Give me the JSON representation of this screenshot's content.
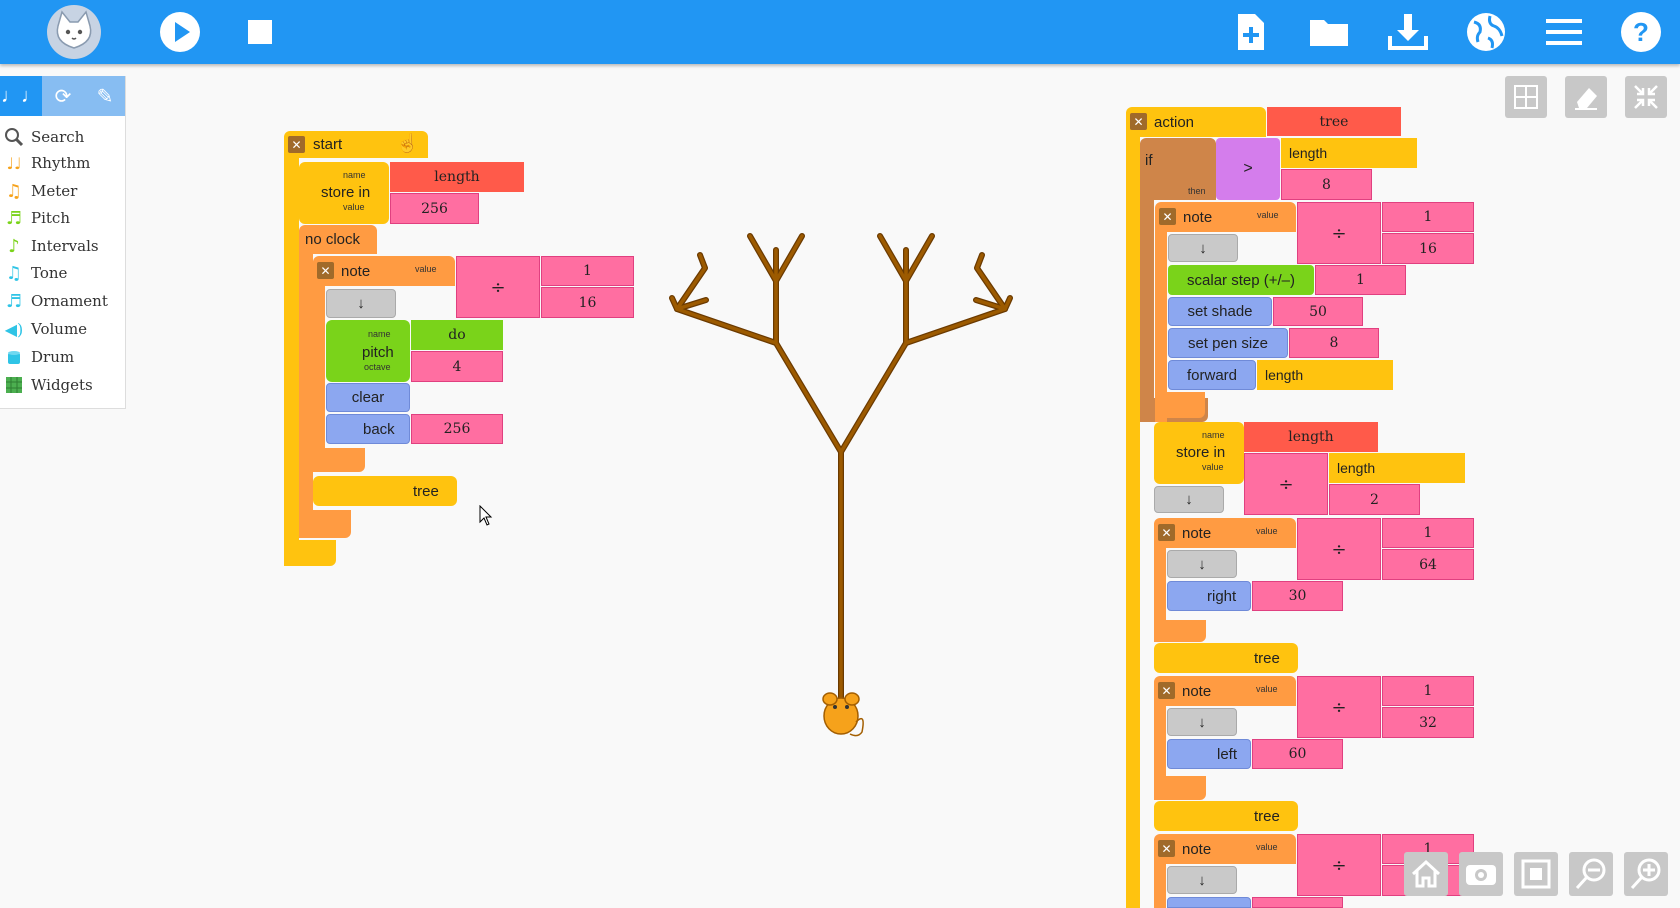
{
  "colors": {
    "topbar": "#2196f3",
    "palette_tab": "#87bdf2",
    "branch": "#9c5a00",
    "mouse": "#f6a21b"
  },
  "toolbar": {
    "left_buttons": [
      "play-icon",
      "stop-icon"
    ],
    "right_buttons": [
      "new-file-icon",
      "open-folder-icon",
      "save-download-icon",
      "planet-icon",
      "menu-icon",
      "help-icon"
    ]
  },
  "palette": {
    "tabs": [
      "music-notes-icon",
      "refresh-icon",
      "pen-icon"
    ],
    "items": [
      {
        "label": "Search",
        "icon": "search-icon"
      },
      {
        "label": "Rhythm",
        "icon": "rhythm-icon"
      },
      {
        "label": "Meter",
        "icon": "meter-icon"
      },
      {
        "label": "Pitch",
        "icon": "pitch-icon"
      },
      {
        "label": "Intervals",
        "icon": "intervals-icon"
      },
      {
        "label": "Tone",
        "icon": "tone-icon"
      },
      {
        "label": "Ornament",
        "icon": "ornament-icon"
      },
      {
        "label": "Volume",
        "icon": "volume-icon"
      },
      {
        "label": "Drum",
        "icon": "drum-icon"
      },
      {
        "label": "Widgets",
        "icon": "widgets-icon"
      }
    ]
  },
  "start_stack": {
    "start": "start",
    "store_in": "store in",
    "name_hint": "name",
    "value_hint": "value",
    "var_name": "length",
    "var_value": "256",
    "no_clock": "no clock",
    "note": "note",
    "note_value_hint": "value",
    "num1": "1",
    "den1": "16",
    "arrow": "↓",
    "pitch": "pitch",
    "octave_hint": "octave",
    "pitch_name": "do",
    "pitch_octave": "4",
    "clear": "clear",
    "back": "back",
    "back_value": "256",
    "tree": "tree"
  },
  "action_stack": {
    "action": "action",
    "action_name": "tree",
    "if": "if",
    "then_hint": "then",
    "gt": ">",
    "cmp_left": "length",
    "cmp_right": "8",
    "note1_num": "1",
    "note1_den": "16",
    "scalar_step": "scalar step (+/–)",
    "scalar_value": "1",
    "set_shade": "set shade",
    "shade_value": "50",
    "set_pen_size": "set pen size",
    "pen_value": "8",
    "forward": "forward",
    "forward_value": "length",
    "store_name": "length",
    "store_arg": "length",
    "store_den": "2",
    "note2_num": "1",
    "note2_den": "64",
    "right": "right",
    "right_value": "30",
    "tree_call1": "tree",
    "note3_num": "1",
    "note3_den": "32",
    "left": "left",
    "left_value": "60",
    "tree_call2": "tree",
    "note4_num": "1"
  },
  "canvas_buttons": [
    "grid-icon",
    "eraser-icon",
    "collapse-icon"
  ],
  "bottom_buttons": [
    "home-icon",
    "eye-icon",
    "reset-zoom-icon",
    "zoom-out-icon",
    "zoom-in-icon"
  ]
}
